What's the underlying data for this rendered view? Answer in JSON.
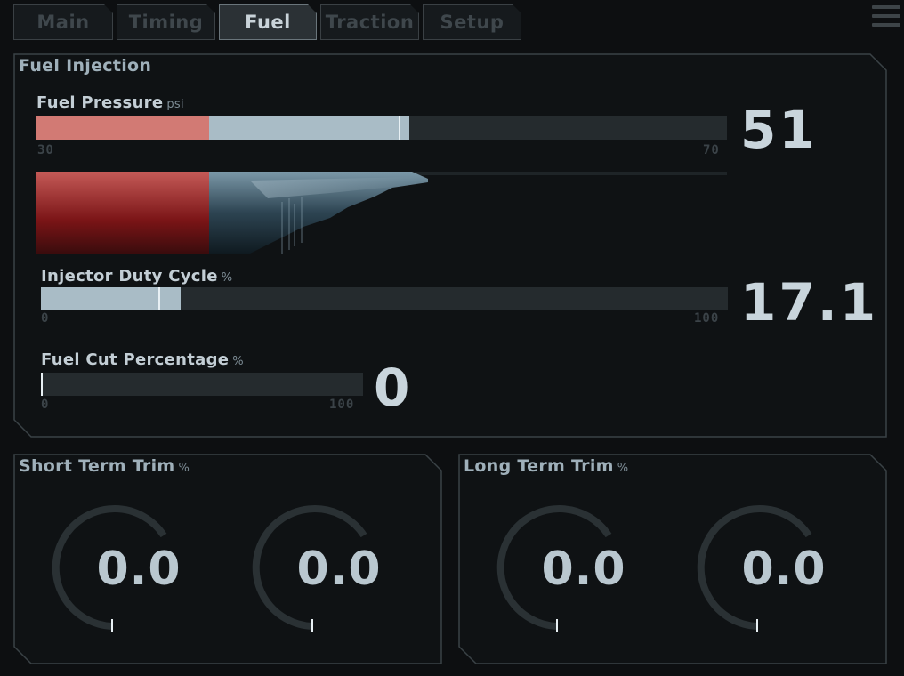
{
  "tabs": [
    {
      "label": "Main",
      "active": false
    },
    {
      "label": "Timing",
      "active": false
    },
    {
      "label": "Fuel",
      "active": true
    },
    {
      "label": "Traction",
      "active": false
    },
    {
      "label": "Setup",
      "active": false
    }
  ],
  "fuel_injection": {
    "title": "Fuel Injection",
    "fuel_pressure": {
      "label": "Fuel Pressure",
      "unit": "psi",
      "min": "30",
      "max": "70",
      "value": "51",
      "min_num": 30,
      "max_num": 70,
      "current": 51,
      "peak": 51.6,
      "red_limit": 40
    },
    "injector_duty": {
      "label": "Injector Duty Cycle",
      "unit": "%",
      "min": "0",
      "max": "100",
      "value": "17.1",
      "min_num": 0,
      "max_num": 100,
      "current": 17.1,
      "peak": 20.4
    },
    "fuel_cut": {
      "label": "Fuel Cut Percentage",
      "unit": "%",
      "min": "0",
      "max": "100",
      "value": "0",
      "min_num": 0,
      "max_num": 100,
      "current": 0
    }
  },
  "short_term_trim": {
    "title": "Short Term Trim",
    "unit": "%",
    "gauges": [
      {
        "value": "0.0"
      },
      {
        "value": "0.0"
      }
    ]
  },
  "long_term_trim": {
    "title": "Long Term Trim",
    "unit": "%",
    "gauges": [
      {
        "value": "0.0"
      },
      {
        "value": "0.0"
      }
    ]
  },
  "colors": {
    "accent_fill": "#a9bcc6",
    "warning_red": "#d27a74",
    "track": "#252b2e",
    "panel_border": "#3a4246"
  }
}
